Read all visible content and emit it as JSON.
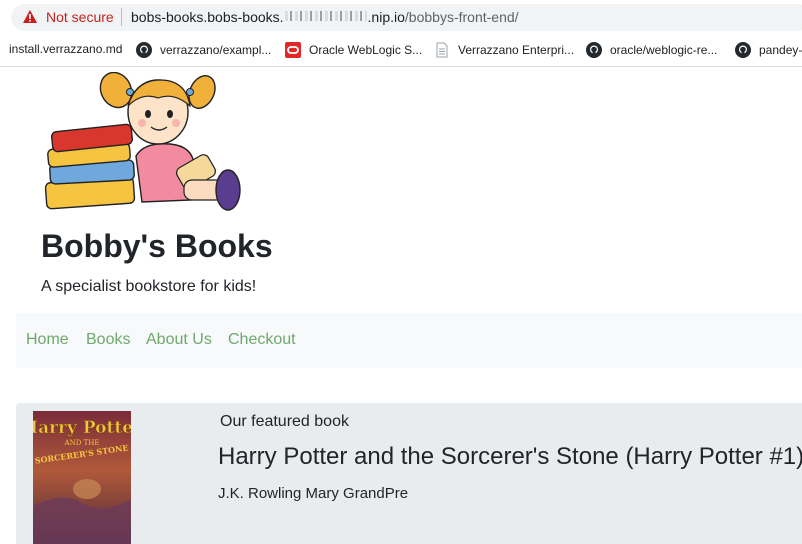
{
  "browser": {
    "security_label": "Not secure",
    "url_host_start": "bobs-books.bobs-books.",
    "url_host_end": ".nip.io",
    "url_path": "/bobbys-front-end/",
    "bookmarks": [
      {
        "label": "install.verrazzano.md",
        "icon": "none"
      },
      {
        "label": "verrazzano/exampl...",
        "icon": "github-icon"
      },
      {
        "label": "Oracle WebLogic S...",
        "icon": "oracle-icon"
      },
      {
        "label": "Verrazzano Enterpri...",
        "icon": "page-icon"
      },
      {
        "label": "oracle/weblogic-re...",
        "icon": "github-icon"
      },
      {
        "label": "pandey-",
        "icon": "github-icon"
      }
    ]
  },
  "site": {
    "title": "Bobby's Books",
    "tagline": "A specialist bookstore for kids!"
  },
  "nav": {
    "items": [
      "Home",
      "Books",
      "About Us",
      "Checkout"
    ],
    "link_color": "#6ea96e"
  },
  "featured": {
    "label": "Our featured book",
    "title": "Harry Potter and the Sorcerer's Stone (Harry Potter #1)",
    "authors": "J.K. Rowling Mary GrandPre",
    "cover_text": [
      "Harry Potter",
      "AND THE",
      "SORCERER'S STONE"
    ]
  },
  "colors": {
    "warning": "#c5221f",
    "nav_bg": "#f8f9fa",
    "featured_bg": "#e9ecef"
  }
}
